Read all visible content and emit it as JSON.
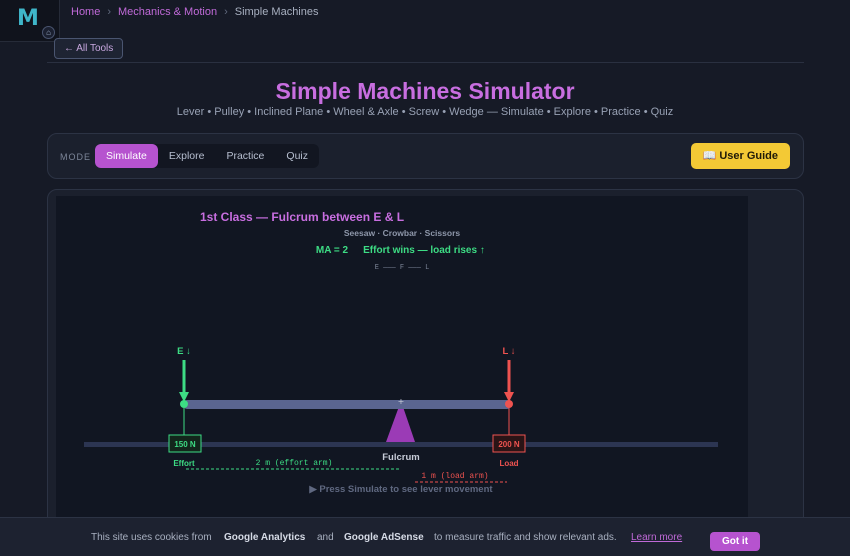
{
  "header": {
    "logo_letter": "M",
    "home_icon": "home-icon",
    "breadcrumb": [
      "Home",
      "Mechanics & Motion",
      "Simple Machines"
    ],
    "breadcrumb_sep": "›",
    "all_tools_label": "← All Tools"
  },
  "page": {
    "title": "Simple Machines Simulator",
    "subtitle": "Lever • Pulley • Inclined Plane • Wheel & Axle • Screw • Wedge — Simulate • Explore • Practice • Quiz"
  },
  "mode_panel": {
    "label": "MODE",
    "tabs": [
      "Simulate",
      "Explore",
      "Practice",
      "Quiz"
    ],
    "active_tab": "Simulate",
    "guide_label": "📖 User Guide"
  },
  "simulation": {
    "class_title": "1st Class — Fulcrum between E & L",
    "examples": "Seesaw · Crowbar · Scissors",
    "ma_text": "MA = 2",
    "status_text": "Effort wins — load rises ↑",
    "order_diagram": "E ——— F ——— L",
    "effort_arrow_label": "E ↓",
    "load_arrow_label": "L ↓",
    "effort_force": "150 N",
    "load_force": "200 N",
    "effort_caption": "Effort",
    "load_caption": "Load",
    "fulcrum_label": "Fulcrum",
    "effort_arm_label": "2 m (effort arm)",
    "load_arm_label": "1 m (load arm)",
    "hint": "▶ Press Simulate to see lever movement",
    "colors": {
      "effort": "#3ddc84",
      "load": "#ef5350",
      "fulcrum": "#9b3bb6",
      "beam": "#5a6590",
      "title": "#c86ee0"
    }
  },
  "cookie_bar": {
    "text_1": "This site uses cookies from",
    "brand_1": "Google Analytics",
    "text_2": "and",
    "brand_2": "Google AdSense",
    "text_3": "to measure traffic and show relevant ads.",
    "learn_more": "Learn more",
    "accept_label": "Got it"
  }
}
